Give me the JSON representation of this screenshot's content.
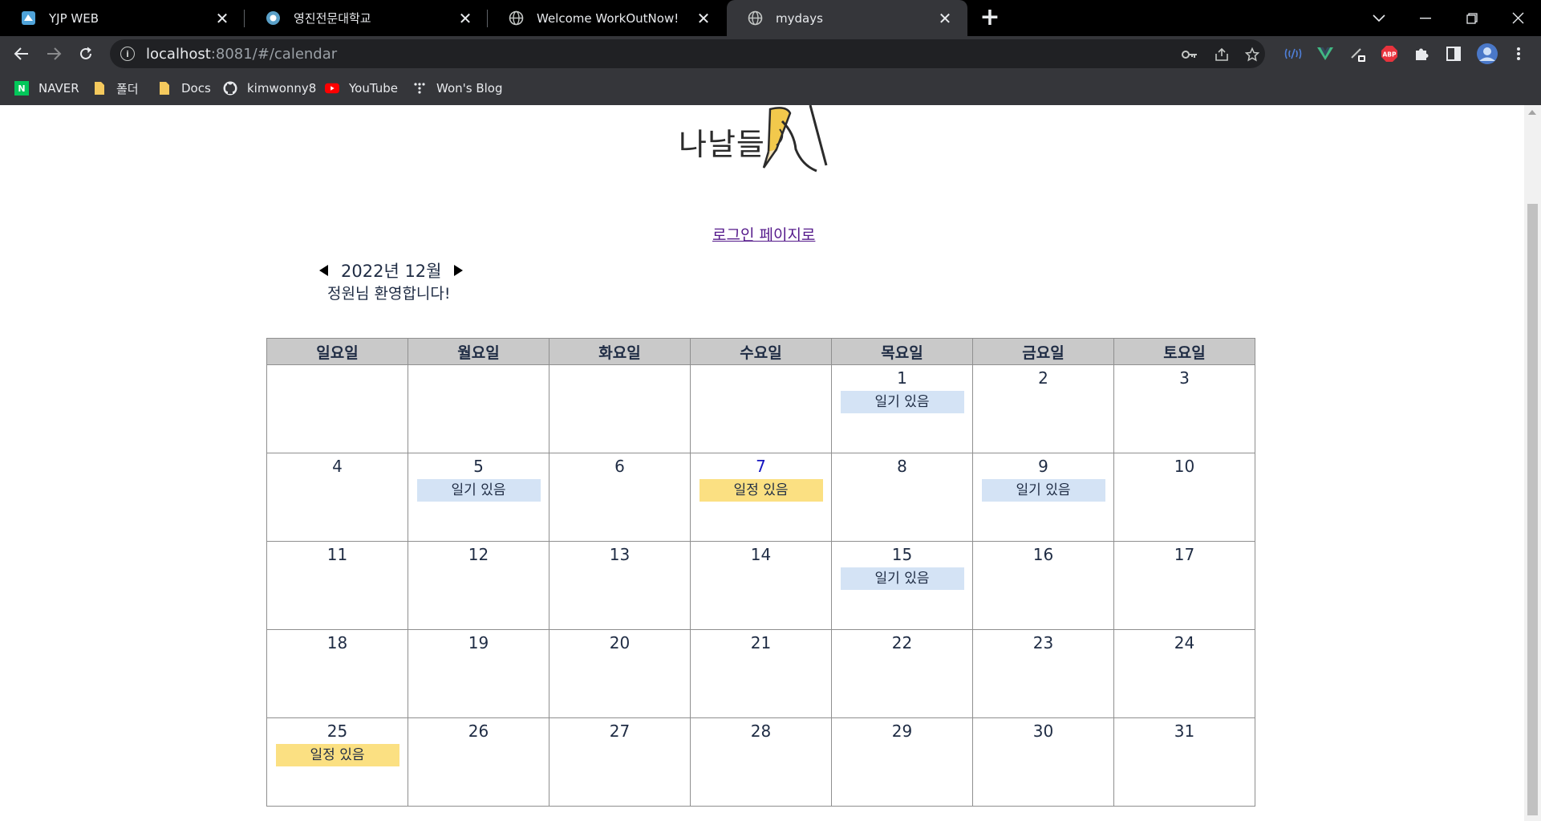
{
  "browser": {
    "tabs": [
      {
        "title": "YJP WEB",
        "icon": "yjp-favicon"
      },
      {
        "title": "영진전문대학교",
        "icon": "yeungjin-favicon"
      },
      {
        "title": "Welcome WorkOutNow!",
        "icon": "globe-icon"
      },
      {
        "title": "mydays",
        "icon": "globe-icon",
        "active": true
      }
    ],
    "address": {
      "host": "localhost",
      "path": ":8081/#/calendar"
    },
    "bookmarks": [
      {
        "label": "NAVER",
        "icon": "naver-icon"
      },
      {
        "label": "폴더",
        "icon": "folder-icon"
      },
      {
        "label": "Docs",
        "icon": "folder-icon"
      },
      {
        "label": "kimwonny8",
        "icon": "github-icon"
      },
      {
        "label": "YouTube",
        "icon": "youtube-icon"
      },
      {
        "label": "Won's Blog",
        "icon": "blog-icon"
      }
    ],
    "extensions": {
      "abp_label": "ABP"
    }
  },
  "page": {
    "logo_text": "나날들",
    "login_link": "로그인 페이지로",
    "month_label": "2022년 12월",
    "welcome": "정원님 환영합니다!"
  },
  "calendar": {
    "weekdays": [
      "일요일",
      "월요일",
      "화요일",
      "수요일",
      "목요일",
      "금요일",
      "토요일"
    ],
    "weeks": [
      [
        {
          "day": ""
        },
        {
          "day": ""
        },
        {
          "day": ""
        },
        {
          "day": ""
        },
        {
          "day": "1",
          "badge": "일기 있음",
          "kind": "diary"
        },
        {
          "day": "2"
        },
        {
          "day": "3"
        }
      ],
      [
        {
          "day": "4"
        },
        {
          "day": "5",
          "badge": "일기 있음",
          "kind": "diary"
        },
        {
          "day": "6"
        },
        {
          "day": "7",
          "badge": "일정 있음",
          "kind": "plan",
          "highlight": true
        },
        {
          "day": "8"
        },
        {
          "day": "9",
          "badge": "일기 있음",
          "kind": "diary"
        },
        {
          "day": "10"
        }
      ],
      [
        {
          "day": "11"
        },
        {
          "day": "12"
        },
        {
          "day": "13"
        },
        {
          "day": "14"
        },
        {
          "day": "15",
          "badge": "일기 있음",
          "kind": "diary"
        },
        {
          "day": "16"
        },
        {
          "day": "17"
        }
      ],
      [
        {
          "day": "18"
        },
        {
          "day": "19"
        },
        {
          "day": "20"
        },
        {
          "day": "21"
        },
        {
          "day": "22"
        },
        {
          "day": "23"
        },
        {
          "day": "24"
        }
      ],
      [
        {
          "day": "25",
          "badge": "일정 있음",
          "kind": "plan"
        },
        {
          "day": "26"
        },
        {
          "day": "27"
        },
        {
          "day": "28"
        },
        {
          "day": "29"
        },
        {
          "day": "30"
        },
        {
          "day": "31"
        }
      ]
    ]
  },
  "colors": {
    "diary_badge": "#d4e3f5",
    "plan_badge": "#fbe082",
    "header_bg": "#c9c9c9",
    "text": "#1f2c44",
    "link": "#551a8b"
  }
}
